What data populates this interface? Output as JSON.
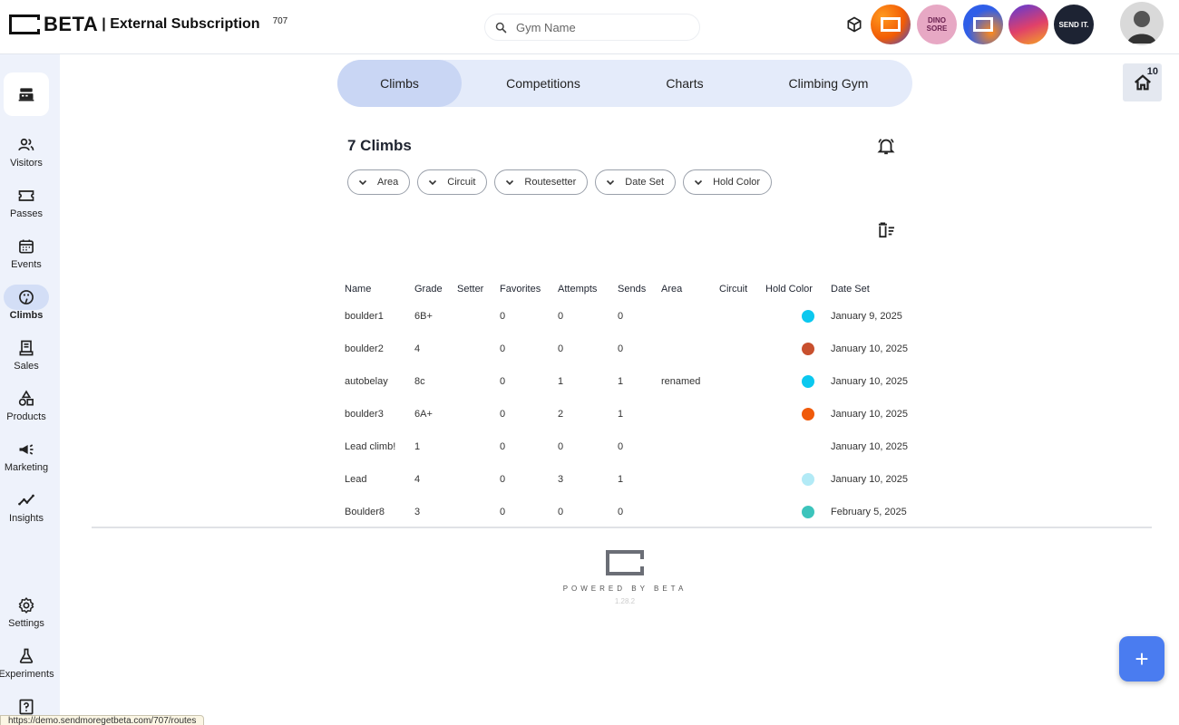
{
  "header": {
    "brand": "BETA",
    "subtitle": "| External Subscription",
    "gym_id": "707",
    "search_placeholder": "Gym Name",
    "avatar2_text": "DINO SORE",
    "avatar5_text": "SEND IT."
  },
  "sidebar": {
    "items": [
      {
        "label": "Visitors",
        "icon": "users-icon"
      },
      {
        "label": "Passes",
        "icon": "ticket-icon"
      },
      {
        "label": "Events",
        "icon": "calendar-icon"
      },
      {
        "label": "Climbs",
        "icon": "climbing-hold-icon"
      },
      {
        "label": "Sales",
        "icon": "receipt-icon"
      },
      {
        "label": "Products",
        "icon": "shapes-icon"
      },
      {
        "label": "Marketing",
        "icon": "megaphone-icon"
      },
      {
        "label": "Insights",
        "icon": "trend-icon"
      },
      {
        "label": "Settings",
        "icon": "gear-icon"
      },
      {
        "label": "Experiments",
        "icon": "flask-icon"
      }
    ],
    "active": "Climbs"
  },
  "tabs": [
    "Climbs",
    "Competitions",
    "Charts",
    "Climbing Gym"
  ],
  "active_tab": "Climbs",
  "home_badge": "10",
  "main": {
    "title": "7 Climbs",
    "filters": [
      "Area",
      "Circuit",
      "Routesetter",
      "Date Set",
      "Hold Color"
    ]
  },
  "table": {
    "columns": [
      "Name",
      "Grade",
      "Setter",
      "Favorites",
      "Attempts",
      "Sends",
      "Area",
      "Circuit",
      "Hold Color",
      "Date Set"
    ],
    "rows": [
      {
        "name": "boulder1",
        "grade": "6B+",
        "setter": "",
        "favorites": "0",
        "attempts": "0",
        "sends": "0",
        "area": "",
        "circuit": "",
        "color": "#0bc8ef",
        "date": "January 9, 2025"
      },
      {
        "name": "boulder2",
        "grade": "4",
        "setter": "",
        "favorites": "0",
        "attempts": "0",
        "sends": "0",
        "area": "",
        "circuit": "",
        "color": "#c8502e",
        "date": "January 10, 2025"
      },
      {
        "name": "autobelay",
        "grade": "8c",
        "setter": "",
        "favorites": "0",
        "attempts": "1",
        "sends": "1",
        "area": "renamed",
        "circuit": "",
        "color": "#0bc8ef",
        "date": "January 10, 2025"
      },
      {
        "name": "boulder3",
        "grade": "6A+",
        "setter": "",
        "favorites": "0",
        "attempts": "2",
        "sends": "1",
        "area": "",
        "circuit": "",
        "color": "#f05a0a",
        "date": "January 10, 2025"
      },
      {
        "name": "Lead climb!",
        "grade": "1",
        "setter": "",
        "favorites": "0",
        "attempts": "0",
        "sends": "0",
        "area": "",
        "circuit": "",
        "color": "",
        "date": "January 10, 2025"
      },
      {
        "name": "Lead",
        "grade": "4",
        "setter": "",
        "favorites": "0",
        "attempts": "3",
        "sends": "1",
        "area": "",
        "circuit": "",
        "color": "#b2eaf6",
        "date": "January 10, 2025"
      },
      {
        "name": "Boulder8",
        "grade": "3",
        "setter": "",
        "favorites": "0",
        "attempts": "0",
        "sends": "0",
        "area": "",
        "circuit": "",
        "color": "#3cc4bc",
        "date": "February 5, 2025"
      }
    ]
  },
  "footer": {
    "powered": "POWERED BY BETA",
    "version": "1.28.2"
  },
  "status_url": "https://demo.sendmoregetbeta.com/707/routes",
  "fab_label": "+"
}
